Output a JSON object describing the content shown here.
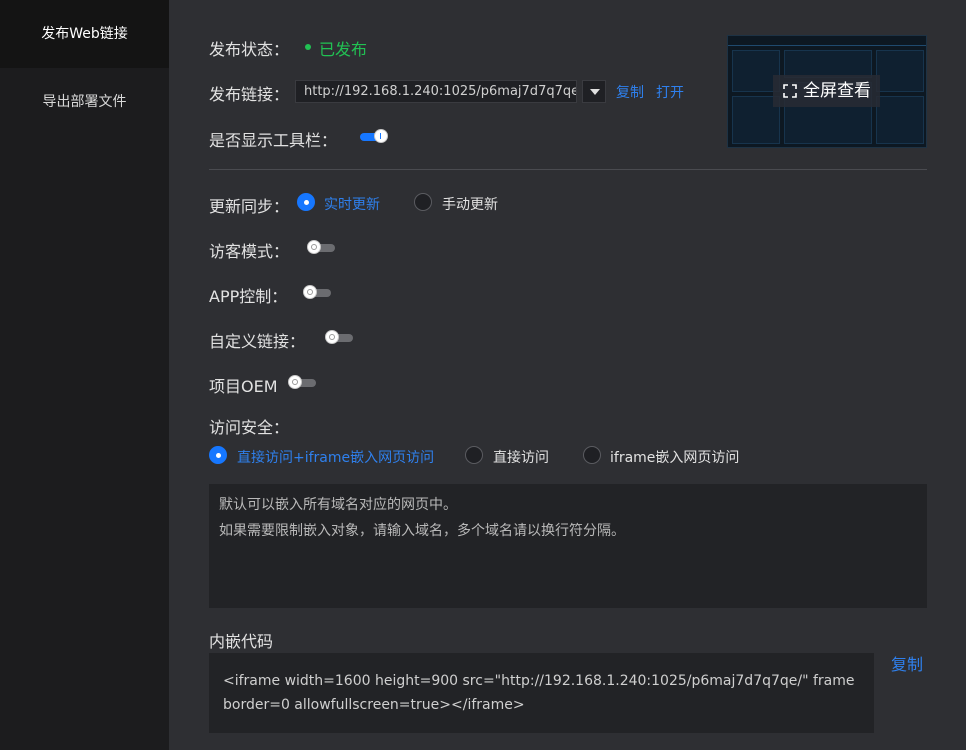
{
  "sidebar": {
    "items": [
      {
        "label": "发布Web链接",
        "active": true
      },
      {
        "label": "导出部署文件",
        "active": false
      }
    ]
  },
  "publish": {
    "status_label": "发布状态：",
    "status_value": "已发布",
    "status_color": "#21c153",
    "link_label": "发布链接：",
    "url": "http://192.168.1.240:1025/p6maj7d7q7qe/",
    "copy_label": "复制",
    "open_label": "打开",
    "toolbar_label": "是否显示工具栏：",
    "toolbar_on": true,
    "fullscreen_label": "全屏查看"
  },
  "settings": {
    "sync_label": "更新同步：",
    "sync_options": [
      {
        "label": "实时更新",
        "checked": true
      },
      {
        "label": "手动更新",
        "checked": false
      }
    ],
    "visitor_label": "访客模式：",
    "app_control_label": "APP控制：",
    "custom_link_label": "自定义链接：",
    "oem_label": "项目OEM",
    "security_label": "访问安全：",
    "security_options": [
      {
        "label": "直接访问+iframe嵌入网页访问",
        "checked": true
      },
      {
        "label": "直接访问",
        "checked": false
      },
      {
        "label": "iframe嵌入网页访问",
        "checked": false
      }
    ],
    "domain_hint_line1": "默认可以嵌入所有域名对应的网页中。",
    "domain_hint_line2": "如果需要限制嵌入对象，请输入域名，多个域名请以换行符分隔。"
  },
  "embed": {
    "title": "内嵌代码",
    "code": "<iframe width=1600 height=900 src=\"http://192.168.1.240:1025/p6maj7d7q7qe/\" frameborder=0 allowfullscreen=true></iframe>",
    "copy_label": "复制"
  },
  "colors": {
    "accent": "#1677ff",
    "link": "#2f80ed",
    "background": "#2e2f33",
    "sidebar": "#1c1c1e"
  }
}
